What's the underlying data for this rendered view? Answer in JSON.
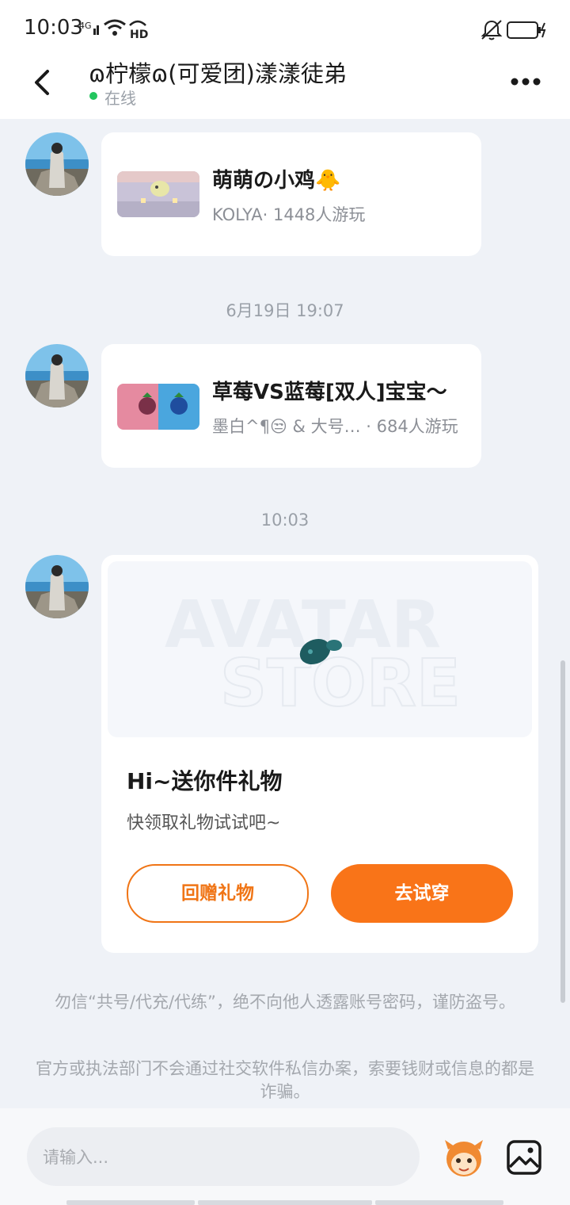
{
  "status_bar": {
    "time": "10:03",
    "network": "4G",
    "icons": [
      "signal-icon",
      "wifi-icon",
      "hd-icon",
      "mute-bell-icon",
      "battery-icon"
    ]
  },
  "header": {
    "title": "ɷ柠檬ɷ(可爱团)漾漾徒弟",
    "status": "在线",
    "status_color": "#22c55e"
  },
  "messages": {
    "game1": {
      "title": "萌萌の小鸡🐥",
      "meta": "KOLYA· 1448人游玩"
    },
    "timestamp1": "6月19日 19:07",
    "game2": {
      "title": "草莓VS蓝莓[双人]宝宝～",
      "meta": "墨白^¶😒 & 大号… · 684人游玩"
    },
    "timestamp2": "10:03",
    "gift": {
      "banner_text_1": "AVATAR",
      "banner_text_2": "STORE",
      "title": "Hi~送你件礼物",
      "subtitle": "快领取礼物试试吧~",
      "return_gift_label": "回赠礼物",
      "try_on_label": "去试穿"
    }
  },
  "notices": {
    "notice1": "勿信“共号/代充/代练”，绝不向他人透露账号密码，谨防盗号。",
    "notice2": "官方或执法部门不会通过社交软件私信办案，索要钱财或信息的都是诈骗。"
  },
  "input_bar": {
    "placeholder": "请输入..."
  },
  "colors": {
    "accent": "#f97418",
    "background": "#eff2f7"
  }
}
